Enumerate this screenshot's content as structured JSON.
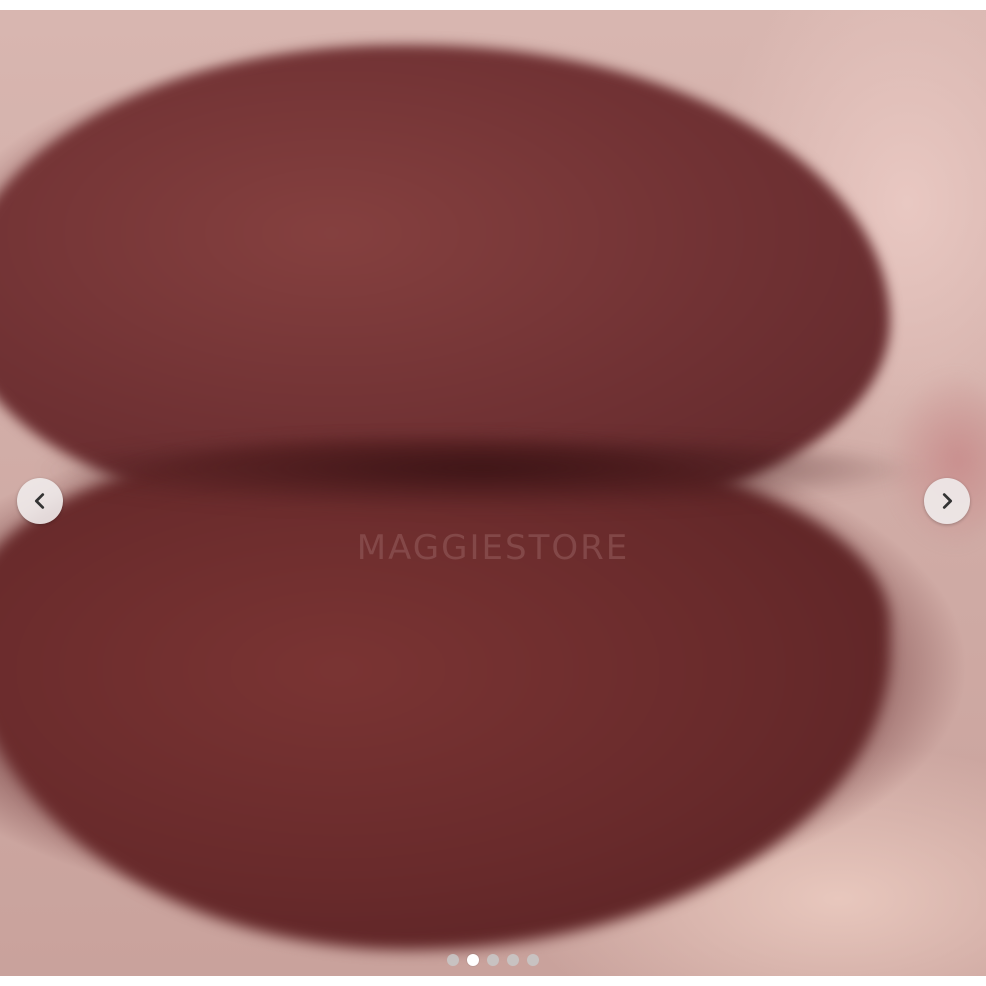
{
  "gallery": {
    "watermark": "MAGGIESTORE",
    "prev_icon": "chevron-left-icon",
    "next_icon": "chevron-right-icon",
    "slide_count": 5,
    "active_slide": 2
  },
  "colors": {
    "lip": "#6e2f33",
    "skin": "#d8b6b0",
    "nav_button": "#f0ebeb",
    "dot_inactive": "#c8c8c8",
    "dot_active": "#ffffff"
  }
}
